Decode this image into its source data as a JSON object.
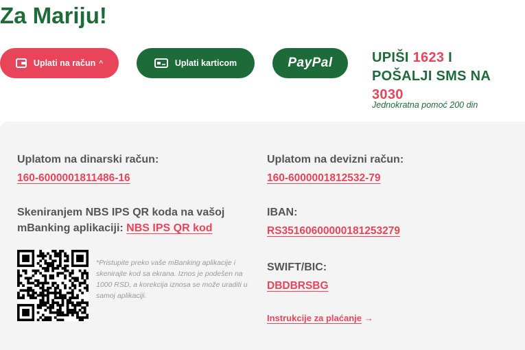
{
  "page_title": "Za Mariju!",
  "buttons": {
    "bank": {
      "label": "Uplati na račun",
      "chevron": "^",
      "icon": "wallet-icon"
    },
    "card": {
      "label": "Uplati karticom",
      "icon": "credit-card-icon"
    },
    "paypal": {
      "label": "PayPal"
    }
  },
  "sms": {
    "line1_prefix": "UPIŠI ",
    "code": "1623",
    "line1_suffix": " I",
    "line2": "POŠALJI SMS NA",
    "number": "3030",
    "note": "Jednokratna pomoć 200 din"
  },
  "dinar": {
    "label": "Uplatom na dinarski račun:",
    "account": "160-6000001811486-16"
  },
  "qr_section": {
    "label_line1": "Skeniranjem NBS IPS QR koda na vašoj",
    "label_line2": "mBanking aplikaciji: ",
    "link": "NBS IPS QR kod",
    "note": "*Pristupite preko vaše mBanking aplikacije i skenirajte kod sa ekrana. Iznos je podešen na 1000 RSD, a korekcija iznosa se može uraditi u samoj aplikaciji."
  },
  "foreign": {
    "label": "Uplatom na devizni račun:",
    "account": "160-6000001812532-79"
  },
  "iban": {
    "label": "IBAN:",
    "value": "RS35160600000181253279"
  },
  "swift": {
    "label": "SWIFT/BIC:",
    "value": "DBDBRSBG"
  },
  "instructions": {
    "label": "Instrukcije za plaćanje",
    "arrow": "→"
  },
  "colors": {
    "brand_green": "#1e6b3a",
    "accent_red": "#e8445a",
    "panel_bg": "#f4f4f4"
  }
}
